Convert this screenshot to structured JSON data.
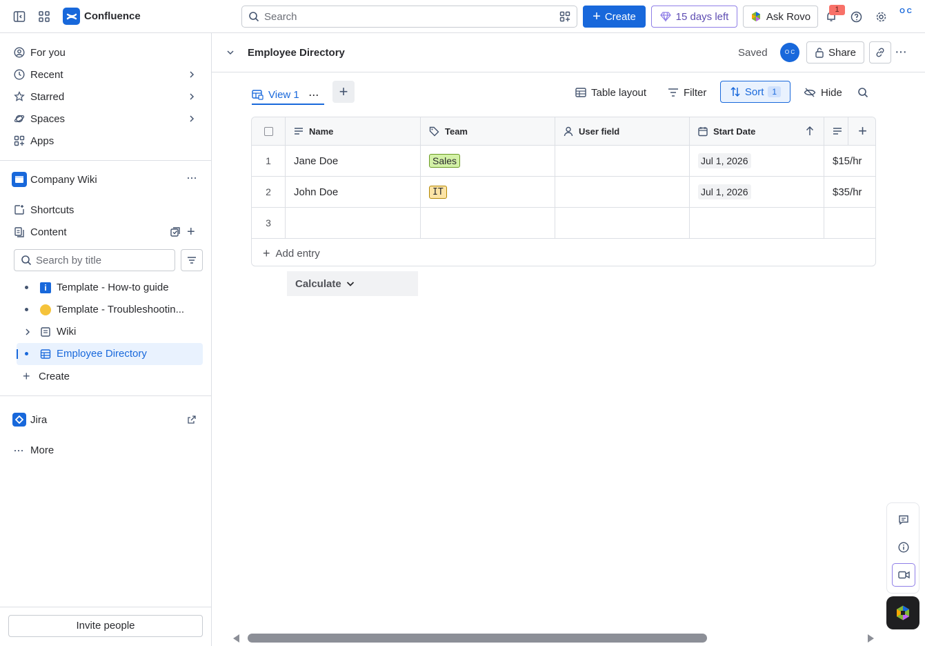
{
  "topbar": {
    "brand": "Confluence",
    "search_placeholder": "Search",
    "create_label": "Create",
    "trial_label": "15 days left",
    "ask_rovo_label": "Ask Rovo",
    "notifications_count": "1",
    "avatar_initials": "O C"
  },
  "sidebar": {
    "nav": [
      {
        "label": "For you"
      },
      {
        "label": "Recent"
      },
      {
        "label": "Starred"
      },
      {
        "label": "Spaces"
      },
      {
        "label": "Apps"
      }
    ],
    "space_name": "Company Wiki",
    "shortcuts_label": "Shortcuts",
    "content_label": "Content",
    "search_placeholder": "Search by title",
    "tree": [
      {
        "label": "Template - How-to guide"
      },
      {
        "label": "Template - Troubleshootin..."
      },
      {
        "label": "Wiki"
      },
      {
        "label": "Employee Directory"
      }
    ],
    "create_label": "Create",
    "jira_label": "Jira",
    "more_label": "More",
    "invite_label": "Invite people"
  },
  "page": {
    "title": "Employee Directory",
    "saved_label": "Saved",
    "avatar_initials": "O C",
    "share_label": "Share"
  },
  "toolbar": {
    "view_label": "View 1",
    "table_layout_label": "Table layout",
    "filter_label": "Filter",
    "sort_label": "Sort",
    "sort_count": "1",
    "hide_label": "Hide"
  },
  "table": {
    "columns": [
      {
        "label": "Name"
      },
      {
        "label": "Team"
      },
      {
        "label": "User field"
      },
      {
        "label": "Start Date"
      }
    ],
    "rows": [
      {
        "num": "1",
        "name": "Jane Doe",
        "team": "Sales",
        "user": "",
        "start": "Jul 1, 2026",
        "rate": "$15/hr"
      },
      {
        "num": "2",
        "name": "John Doe",
        "team": "IT",
        "user": "",
        "start": "Jul 1, 2026",
        "rate": "$35/hr"
      },
      {
        "num": "3",
        "name": "",
        "team": "",
        "user": "",
        "start": "",
        "rate": ""
      }
    ],
    "add_entry_label": "Add entry",
    "calculate_label": "Calculate"
  },
  "colors": {
    "accent": "#1868db",
    "sales_bg": "#d3f1a7",
    "sales_border": "#6a9a23",
    "it_bg": "#fce4a6",
    "it_border": "#b38600"
  }
}
